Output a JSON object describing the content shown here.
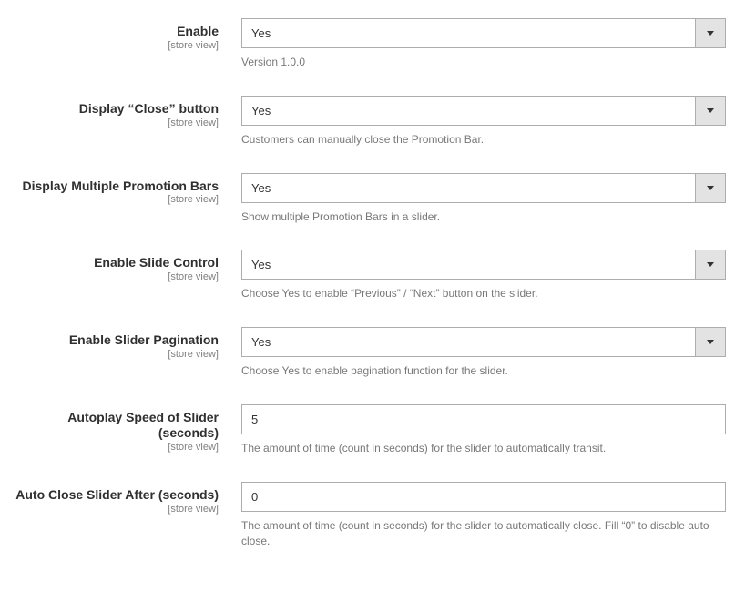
{
  "scope_label": "[store view]",
  "fields": {
    "enable": {
      "label": "Enable",
      "value": "Yes",
      "note": "Version 1.0.0"
    },
    "display_close": {
      "label": "Display “Close” button",
      "value": "Yes",
      "note": "Customers can manually close the Promotion Bar."
    },
    "display_multiple": {
      "label": "Display Multiple Promotion Bars",
      "value": "Yes",
      "note": "Show multiple Promotion Bars in a slider."
    },
    "slide_control": {
      "label": "Enable Slide Control",
      "value": "Yes",
      "note": "Choose Yes to enable “Previous” / “Next” button on the slider."
    },
    "slider_pagination": {
      "label": "Enable Slider Pagination",
      "value": "Yes",
      "note": "Choose Yes to enable pagination function for the slider."
    },
    "autoplay_speed": {
      "label": "Autoplay Speed of Slider (seconds)",
      "value": "5",
      "note": "The amount of time (count in seconds) for the slider to automatically transit."
    },
    "auto_close": {
      "label": "Auto Close Slider After (seconds)",
      "value": "0",
      "note": "The amount of time (count in seconds) for the slider to automatically close. Fill “0” to disable auto close."
    }
  }
}
